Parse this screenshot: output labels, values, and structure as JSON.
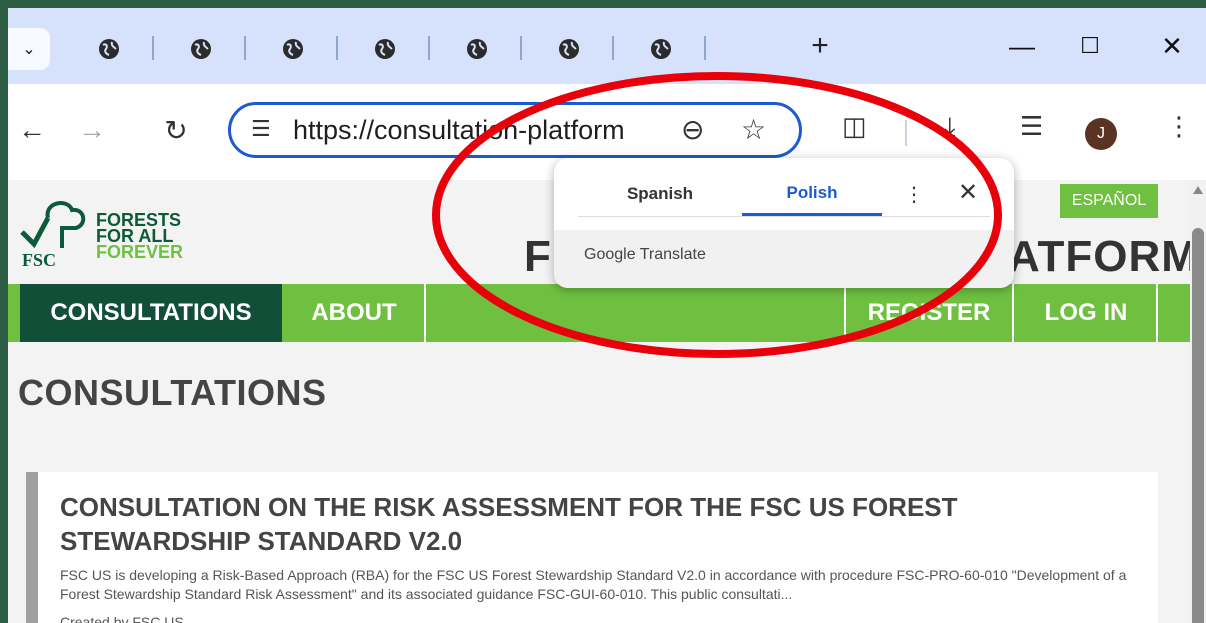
{
  "browser": {
    "tab_count": 7,
    "new_tab_label": "+",
    "minimize": "—",
    "maximize": "☐",
    "close": "✕",
    "url": "https://consultation-platform",
    "avatar_letter": "J"
  },
  "page": {
    "lang_badge": "ESPAÑOL",
    "logo": {
      "line1": "FORESTS",
      "line2": "FOR ALL",
      "line3": "FOREVER",
      "fsc": "FSC"
    },
    "title_left": "F",
    "title_right": "ATFORM",
    "nav": {
      "consultations": "CONSULTATIONS",
      "about": "ABOUT",
      "register": "REGISTER",
      "login": "LOG IN"
    },
    "heading": "CONSULTATIONS",
    "card": {
      "title": "CONSULTATION ON THE RISK ASSESSMENT FOR THE FSC US FOREST STEWARDSHIP STANDARD V2.0",
      "description": "FSC US is developing a Risk-Based Approach (RBA) for the FSC US Forest Stewardship Standard V2.0 in accordance with procedure FSC-PRO-60-010 \"Development of a Forest Stewardship Standard Risk Assessment\" and its associated guidance FSC-GUI-60-010. This public consultati...",
      "created": "Created by FSC US"
    }
  },
  "translate_popup": {
    "tab_spanish": "Spanish",
    "tab_polish": "Polish",
    "more": "⋮",
    "close": "✕",
    "footer": "Google Translate"
  },
  "colors": {
    "accent_green": "#6fc040",
    "dark_green": "#114f39",
    "link_blue": "#1b5ad1",
    "annotation_red": "#e8000b"
  }
}
